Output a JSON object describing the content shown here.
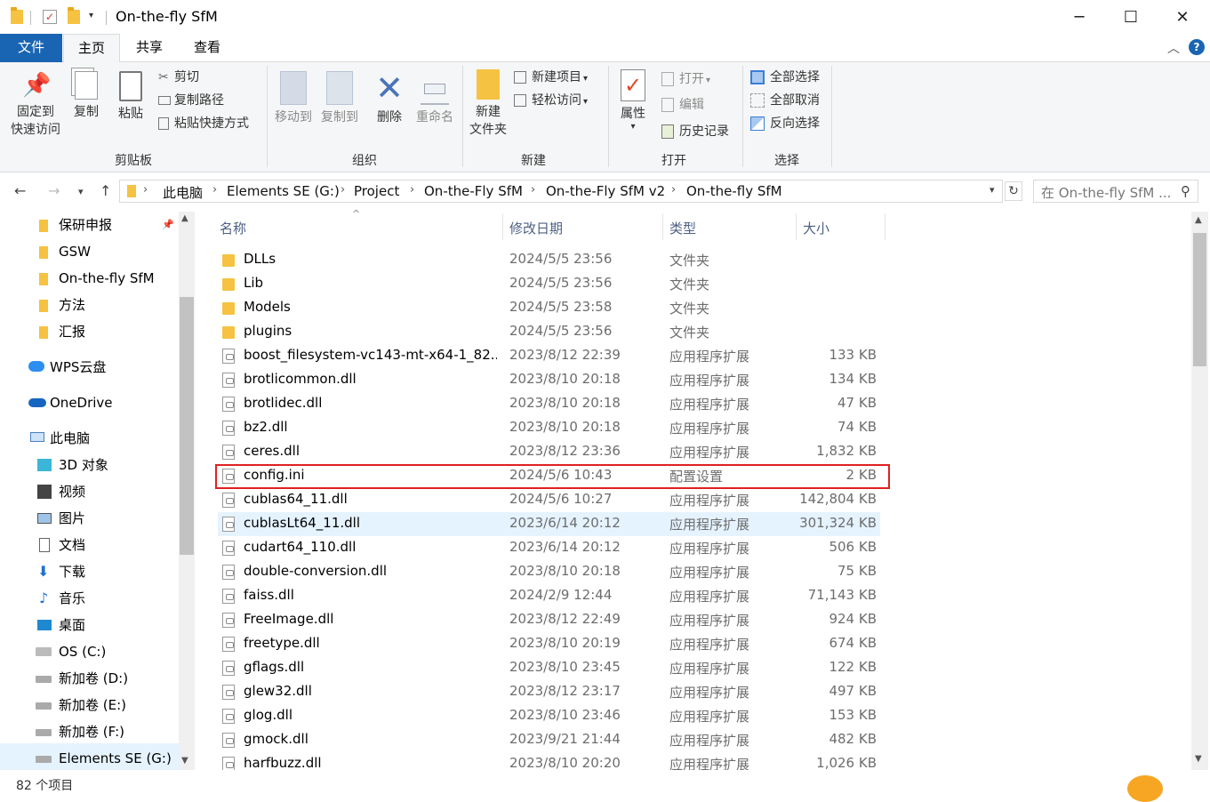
{
  "window": {
    "title": "On-the-fly SfM",
    "controls": {
      "minimize": "─",
      "maximize": "☐",
      "close": "✕"
    }
  },
  "ribbon_tabs": [
    "文件",
    "主页",
    "共享",
    "查看"
  ],
  "ribbon": {
    "clipboard": {
      "label": "剪贴板",
      "pin_line1": "固定到",
      "pin_line2": "快速访问",
      "copy": "复制",
      "paste": "粘贴",
      "cut": "剪切",
      "copy_path": "复制路径",
      "paste_shortcut": "粘贴快捷方式"
    },
    "organize": {
      "label": "组织",
      "move_to": "移动到",
      "copy_to": "复制到",
      "delete": "删除",
      "rename": "重命名"
    },
    "new": {
      "label": "新建",
      "new_folder_line1": "新建",
      "new_folder_line2": "文件夹",
      "new_item": "新建项目",
      "easy_access": "轻松访问"
    },
    "open": {
      "label": "打开",
      "properties": "属性",
      "open": "打开",
      "edit": "编辑",
      "history": "历史记录"
    },
    "select": {
      "label": "选择",
      "select_all": "全部选择",
      "select_none": "全部取消",
      "invert": "反向选择"
    }
  },
  "breadcrumb": [
    "此电脑",
    "Elements SE (G:)",
    "Project",
    "On-the-Fly SfM",
    "On-the-Fly SfM v2",
    "On-the-fly SfM"
  ],
  "search_placeholder": "在 On-the-fly SfM ...",
  "nav": {
    "quick": [
      "保研申报",
      "GSW",
      "On-the-fly SfM",
      "方法",
      "汇报"
    ],
    "wps": "WPS云盘",
    "onedrive": "OneDrive",
    "thispc": "此电脑",
    "pc_items": [
      "3D 对象",
      "视频",
      "图片",
      "文档",
      "下载",
      "音乐",
      "桌面",
      "OS (C:)",
      "新加卷 (D:)",
      "新加卷 (E:)",
      "新加卷 (F:)",
      "Elements SE (G:)"
    ]
  },
  "columns": {
    "name": "名称",
    "date": "修改日期",
    "type": "类型",
    "size": "大小"
  },
  "files": [
    {
      "name": "DLLs",
      "date": "2024/5/5 23:56",
      "type": "文件夹",
      "size": "",
      "kind": "folder"
    },
    {
      "name": "Lib",
      "date": "2024/5/5 23:56",
      "type": "文件夹",
      "size": "",
      "kind": "folder"
    },
    {
      "name": "Models",
      "date": "2024/5/5 23:58",
      "type": "文件夹",
      "size": "",
      "kind": "folder"
    },
    {
      "name": "plugins",
      "date": "2024/5/5 23:56",
      "type": "文件夹",
      "size": "",
      "kind": "folder"
    },
    {
      "name": "boost_filesystem-vc143-mt-x64-1_82...",
      "date": "2023/8/12 22:39",
      "type": "应用程序扩展",
      "size": "133 KB",
      "kind": "file"
    },
    {
      "name": "brotlicommon.dll",
      "date": "2023/8/10 20:18",
      "type": "应用程序扩展",
      "size": "134 KB",
      "kind": "file"
    },
    {
      "name": "brotlidec.dll",
      "date": "2023/8/10 20:18",
      "type": "应用程序扩展",
      "size": "47 KB",
      "kind": "file"
    },
    {
      "name": "bz2.dll",
      "date": "2023/8/10 20:18",
      "type": "应用程序扩展",
      "size": "74 KB",
      "kind": "file"
    },
    {
      "name": "ceres.dll",
      "date": "2023/8/12 23:36",
      "type": "应用程序扩展",
      "size": "1,832 KB",
      "kind": "file"
    },
    {
      "name": "config.ini",
      "date": "2024/5/6 10:43",
      "type": "配置设置",
      "size": "2 KB",
      "kind": "file"
    },
    {
      "name": "cublas64_11.dll",
      "date": "2024/5/6 10:27",
      "type": "应用程序扩展",
      "size": "142,804 KB",
      "kind": "file"
    },
    {
      "name": "cublasLt64_11.dll",
      "date": "2023/6/14 20:12",
      "type": "应用程序扩展",
      "size": "301,324 KB",
      "kind": "file"
    },
    {
      "name": "cudart64_110.dll",
      "date": "2023/6/14 20:12",
      "type": "应用程序扩展",
      "size": "506 KB",
      "kind": "file"
    },
    {
      "name": "double-conversion.dll",
      "date": "2023/8/10 20:18",
      "type": "应用程序扩展",
      "size": "75 KB",
      "kind": "file"
    },
    {
      "name": "faiss.dll",
      "date": "2024/2/9 12:44",
      "type": "应用程序扩展",
      "size": "71,143 KB",
      "kind": "file"
    },
    {
      "name": "FreeImage.dll",
      "date": "2023/8/12 22:49",
      "type": "应用程序扩展",
      "size": "924 KB",
      "kind": "file"
    },
    {
      "name": "freetype.dll",
      "date": "2023/8/10 20:19",
      "type": "应用程序扩展",
      "size": "674 KB",
      "kind": "file"
    },
    {
      "name": "gflags.dll",
      "date": "2023/8/10 23:45",
      "type": "应用程序扩展",
      "size": "122 KB",
      "kind": "file"
    },
    {
      "name": "glew32.dll",
      "date": "2023/8/12 23:17",
      "type": "应用程序扩展",
      "size": "497 KB",
      "kind": "file"
    },
    {
      "name": "glog.dll",
      "date": "2023/8/10 23:46",
      "type": "应用程序扩展",
      "size": "153 KB",
      "kind": "file"
    },
    {
      "name": "gmock.dll",
      "date": "2023/9/21 21:44",
      "type": "应用程序扩展",
      "size": "482 KB",
      "kind": "file"
    },
    {
      "name": "harfbuzz.dll",
      "date": "2023/8/10 20:20",
      "type": "应用程序扩展",
      "size": "1,026 KB",
      "kind": "file"
    }
  ],
  "status": {
    "count": "82 个项目"
  },
  "colors": {
    "accent": "#1a65b3",
    "highlight_border": "#e02020",
    "hover_row": "#e5f3ff"
  }
}
